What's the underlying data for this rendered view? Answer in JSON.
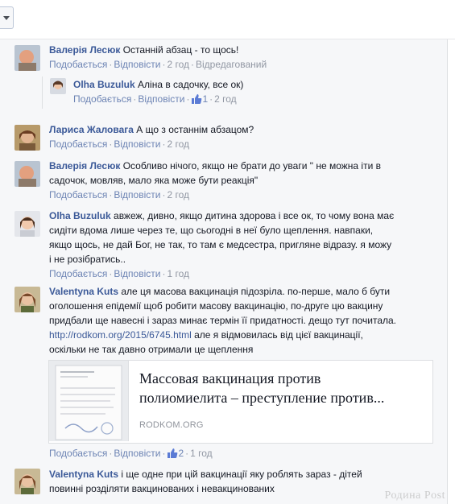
{
  "actions": {
    "like": "Подобається",
    "reply": "Відповісти",
    "separator": "·"
  },
  "comments": [
    {
      "name": "Валерія Лесюк",
      "text": "Останній абзац - то щось!",
      "time": "2 год",
      "extra": "Відредагований"
    },
    {
      "name": "Olha Buzuluk",
      "text": "Аліна в садочку, все ок)",
      "likes": "1",
      "time": "2 год"
    },
    {
      "name": "Лариса Жаловага",
      "text": "А що з останнім абзацом?",
      "time": "2 год"
    },
    {
      "name": "Валерія Лесюк",
      "text_line1": "Особливо нічого, якщо не брати до уваги \" не можна іти в",
      "text_line2": "садочок, мовляв, мало яка може бути реакція\"",
      "time": "2 год"
    },
    {
      "name": "Olha Buzuluk",
      "text_line1": "авжеж, дивно, якщо дитина здорова і все ок, то чому вона має",
      "text_line2": "сидіти вдома лише через те, що сьогодні в неї було щеплення. навпаки,",
      "text_line3": "якщо щось, не дай Бог, не так, то там є медсестра, пригляне відразу. я можу",
      "text_line4": "і не розібратись..",
      "time": "1 год"
    },
    {
      "name": "Valentyna Kuts",
      "text_line1": "але ця масова вакцинація підозріла. по-перше, мало б бути",
      "text_line2": "оголошення епідемії щоб робити масову вакцинацію, по-друге цю вакцину",
      "text_line3": "придбали ще навесні і зараз минає термін її придатності. дещо тут почитала.",
      "link": "http://rodkom.org/2015/6745.html",
      "text_line4": " але я відмовилась від цієї вакцинації,",
      "text_line5": "оскільки не так давно отримали це щеплення",
      "likes": "2",
      "time": "1 год"
    },
    {
      "name": "Valentyna Kuts",
      "text_line1": "і ще одне при цій вакцинації яку роблять зараз - дітей",
      "text_line2": "повинні розділяти вакцинованих і невакцинованих"
    }
  ],
  "preview": {
    "title_line1": "Массовая вакцинация против",
    "title_line2": "полиомиелита – преступление против...",
    "domain": "RODKOM.ORG"
  },
  "watermark": "Родина Post",
  "icons": {
    "like": "thumbs-up-icon",
    "dropdown": "chevron-down-icon"
  },
  "colors": {
    "name": "#3b5998",
    "meta": "#9197a3",
    "action": "#6d84b4",
    "panel": "#f6f7f9"
  }
}
